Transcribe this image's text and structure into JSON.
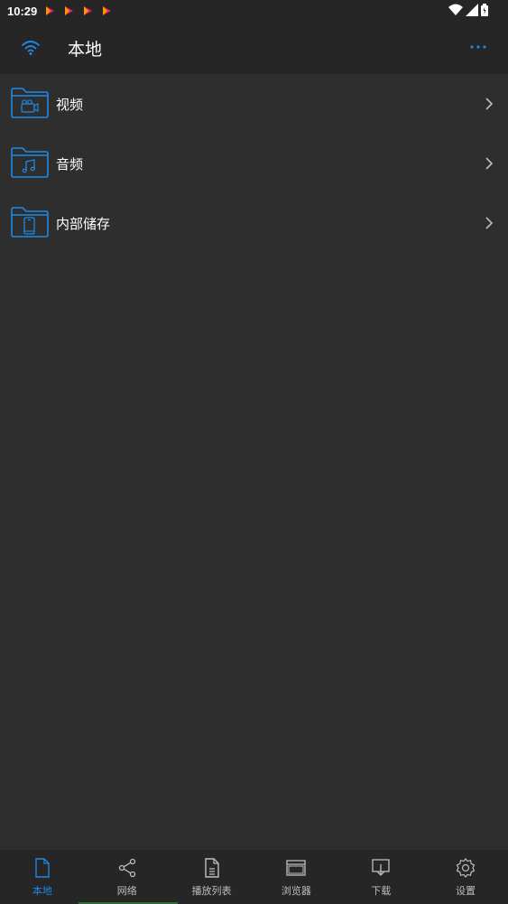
{
  "status_bar": {
    "time": "10:29",
    "notification_icons": [
      "play-store-icon",
      "play-store-icon",
      "play-store-icon",
      "play-store-icon"
    ],
    "right_icons": [
      "wifi-icon",
      "signal-icon",
      "battery-icon"
    ]
  },
  "app_bar": {
    "title": "本地",
    "left_icon": "wifi-icon",
    "right_icon": "more-icon"
  },
  "list": {
    "items": [
      {
        "label": "视频",
        "icon": "video-folder-icon"
      },
      {
        "label": "音频",
        "icon": "music-folder-icon"
      },
      {
        "label": "内部储存",
        "icon": "phone-storage-folder-icon"
      }
    ]
  },
  "bottom_nav": {
    "active_index": 0,
    "items": [
      {
        "label": "本地",
        "icon": "file-icon"
      },
      {
        "label": "网络",
        "icon": "share-icon"
      },
      {
        "label": "播放列表",
        "icon": "document-icon"
      },
      {
        "label": "浏览器",
        "icon": "browser-window-icon"
      },
      {
        "label": "下载",
        "icon": "download-icon"
      },
      {
        "label": "设置",
        "icon": "gear-icon"
      }
    ]
  },
  "colors": {
    "accent": "#1e88e5",
    "background": "#2e2e2e",
    "bar_background": "#262626"
  }
}
